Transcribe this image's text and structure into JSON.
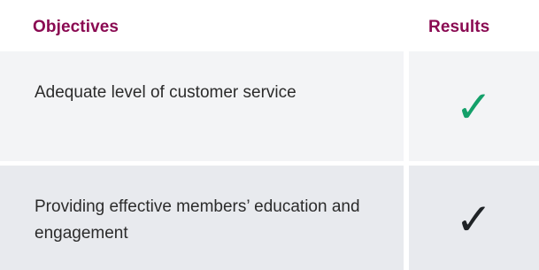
{
  "colors": {
    "header_text": "#8a0a52",
    "row_odd_bg": "#f3f4f6",
    "row_even_bg": "#e8eaee",
    "check_green": "#14a06a",
    "check_dark": "#1f2326"
  },
  "table": {
    "headers": {
      "objectives": "Objectives",
      "results": "Results"
    },
    "rows": [
      {
        "objective": "Adequate level of customer service",
        "result_symbol": "✓",
        "result_icon": "check-green-icon"
      },
      {
        "objective": "Providing effective members’ education and engagement",
        "result_symbol": "✓",
        "result_icon": "check-dark-icon"
      }
    ]
  }
}
